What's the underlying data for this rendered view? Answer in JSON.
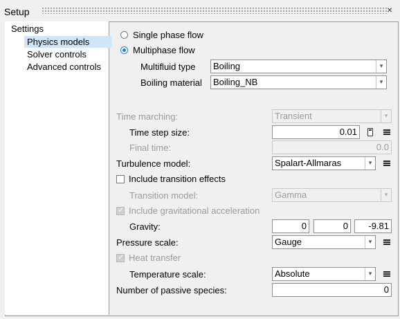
{
  "window": {
    "title": "Setup",
    "close": "×"
  },
  "tree": {
    "root": "Settings",
    "items": [
      {
        "label": "Physics models",
        "selected": true
      },
      {
        "label": "Solver controls",
        "selected": false
      },
      {
        "label": "Advanced controls",
        "selected": false
      }
    ]
  },
  "flow": {
    "single_label": "Single phase flow",
    "multi_label": "Multiphase flow",
    "selected": "Multiphase flow",
    "multifluid_type_label": "Multifluid type",
    "multifluid_type_value": "Boiling",
    "boiling_material_label": "Boiling material",
    "boiling_material_value": "Boiling_NB"
  },
  "time": {
    "marching_label": "Time marching:",
    "marching_value": "Transient",
    "step_label": "Time step size:",
    "step_value": "0.01",
    "final_label": "Final time:",
    "final_value": "0.0"
  },
  "turbulence": {
    "label": "Turbulence model:",
    "value": "Spalart-Allmaras"
  },
  "transition": {
    "checkbox_label": "Include transition effects",
    "checked": false,
    "model_label": "Transition model:",
    "model_value": "Gamma"
  },
  "gravity": {
    "checkbox_label": "Include gravitational acceleration",
    "checked": true,
    "label": "Gravity:",
    "x": "0",
    "y": "0",
    "z": "-9.81"
  },
  "pressure": {
    "label": "Pressure scale:",
    "value": "Gauge"
  },
  "heat": {
    "checkbox_label": "Heat transfer",
    "checked": true,
    "temp_label": "Temperature scale:",
    "temp_value": "Absolute"
  },
  "species": {
    "label": "Number of passive species:",
    "value": "0"
  },
  "icons": {
    "dropdown": "chevron-down-icon",
    "menu": "menu-icon",
    "calculator": "calculator-icon"
  },
  "colors": {
    "selection": "#cfe5f8",
    "radio_accent": "#2a7ad5"
  }
}
